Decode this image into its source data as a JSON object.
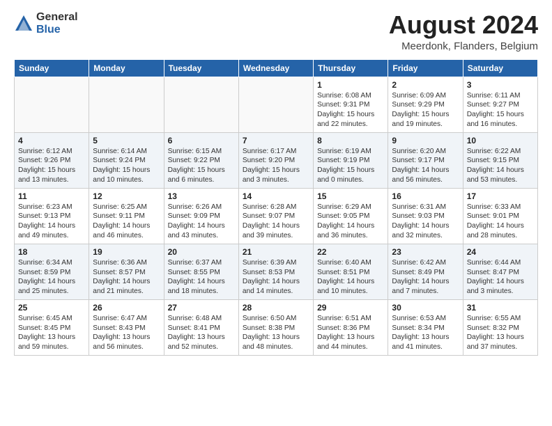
{
  "logo": {
    "general": "General",
    "blue": "Blue"
  },
  "title": "August 2024",
  "location": "Meerdonk, Flanders, Belgium",
  "days_of_week": [
    "Sunday",
    "Monday",
    "Tuesday",
    "Wednesday",
    "Thursday",
    "Friday",
    "Saturday"
  ],
  "weeks": [
    [
      {
        "day": "",
        "info": ""
      },
      {
        "day": "",
        "info": ""
      },
      {
        "day": "",
        "info": ""
      },
      {
        "day": "",
        "info": ""
      },
      {
        "day": "1",
        "info": "Sunrise: 6:08 AM\nSunset: 9:31 PM\nDaylight: 15 hours\nand 22 minutes."
      },
      {
        "day": "2",
        "info": "Sunrise: 6:09 AM\nSunset: 9:29 PM\nDaylight: 15 hours\nand 19 minutes."
      },
      {
        "day": "3",
        "info": "Sunrise: 6:11 AM\nSunset: 9:27 PM\nDaylight: 15 hours\nand 16 minutes."
      }
    ],
    [
      {
        "day": "4",
        "info": "Sunrise: 6:12 AM\nSunset: 9:26 PM\nDaylight: 15 hours\nand 13 minutes."
      },
      {
        "day": "5",
        "info": "Sunrise: 6:14 AM\nSunset: 9:24 PM\nDaylight: 15 hours\nand 10 minutes."
      },
      {
        "day": "6",
        "info": "Sunrise: 6:15 AM\nSunset: 9:22 PM\nDaylight: 15 hours\nand 6 minutes."
      },
      {
        "day": "7",
        "info": "Sunrise: 6:17 AM\nSunset: 9:20 PM\nDaylight: 15 hours\nand 3 minutes."
      },
      {
        "day": "8",
        "info": "Sunrise: 6:19 AM\nSunset: 9:19 PM\nDaylight: 15 hours\nand 0 minutes."
      },
      {
        "day": "9",
        "info": "Sunrise: 6:20 AM\nSunset: 9:17 PM\nDaylight: 14 hours\nand 56 minutes."
      },
      {
        "day": "10",
        "info": "Sunrise: 6:22 AM\nSunset: 9:15 PM\nDaylight: 14 hours\nand 53 minutes."
      }
    ],
    [
      {
        "day": "11",
        "info": "Sunrise: 6:23 AM\nSunset: 9:13 PM\nDaylight: 14 hours\nand 49 minutes."
      },
      {
        "day": "12",
        "info": "Sunrise: 6:25 AM\nSunset: 9:11 PM\nDaylight: 14 hours\nand 46 minutes."
      },
      {
        "day": "13",
        "info": "Sunrise: 6:26 AM\nSunset: 9:09 PM\nDaylight: 14 hours\nand 43 minutes."
      },
      {
        "day": "14",
        "info": "Sunrise: 6:28 AM\nSunset: 9:07 PM\nDaylight: 14 hours\nand 39 minutes."
      },
      {
        "day": "15",
        "info": "Sunrise: 6:29 AM\nSunset: 9:05 PM\nDaylight: 14 hours\nand 36 minutes."
      },
      {
        "day": "16",
        "info": "Sunrise: 6:31 AM\nSunset: 9:03 PM\nDaylight: 14 hours\nand 32 minutes."
      },
      {
        "day": "17",
        "info": "Sunrise: 6:33 AM\nSunset: 9:01 PM\nDaylight: 14 hours\nand 28 minutes."
      }
    ],
    [
      {
        "day": "18",
        "info": "Sunrise: 6:34 AM\nSunset: 8:59 PM\nDaylight: 14 hours\nand 25 minutes."
      },
      {
        "day": "19",
        "info": "Sunrise: 6:36 AM\nSunset: 8:57 PM\nDaylight: 14 hours\nand 21 minutes."
      },
      {
        "day": "20",
        "info": "Sunrise: 6:37 AM\nSunset: 8:55 PM\nDaylight: 14 hours\nand 18 minutes."
      },
      {
        "day": "21",
        "info": "Sunrise: 6:39 AM\nSunset: 8:53 PM\nDaylight: 14 hours\nand 14 minutes."
      },
      {
        "day": "22",
        "info": "Sunrise: 6:40 AM\nSunset: 8:51 PM\nDaylight: 14 hours\nand 10 minutes."
      },
      {
        "day": "23",
        "info": "Sunrise: 6:42 AM\nSunset: 8:49 PM\nDaylight: 14 hours\nand 7 minutes."
      },
      {
        "day": "24",
        "info": "Sunrise: 6:44 AM\nSunset: 8:47 PM\nDaylight: 14 hours\nand 3 minutes."
      }
    ],
    [
      {
        "day": "25",
        "info": "Sunrise: 6:45 AM\nSunset: 8:45 PM\nDaylight: 13 hours\nand 59 minutes."
      },
      {
        "day": "26",
        "info": "Sunrise: 6:47 AM\nSunset: 8:43 PM\nDaylight: 13 hours\nand 56 minutes."
      },
      {
        "day": "27",
        "info": "Sunrise: 6:48 AM\nSunset: 8:41 PM\nDaylight: 13 hours\nand 52 minutes."
      },
      {
        "day": "28",
        "info": "Sunrise: 6:50 AM\nSunset: 8:38 PM\nDaylight: 13 hours\nand 48 minutes."
      },
      {
        "day": "29",
        "info": "Sunrise: 6:51 AM\nSunset: 8:36 PM\nDaylight: 13 hours\nand 44 minutes."
      },
      {
        "day": "30",
        "info": "Sunrise: 6:53 AM\nSunset: 8:34 PM\nDaylight: 13 hours\nand 41 minutes."
      },
      {
        "day": "31",
        "info": "Sunrise: 6:55 AM\nSunset: 8:32 PM\nDaylight: 13 hours\nand 37 minutes."
      }
    ]
  ]
}
